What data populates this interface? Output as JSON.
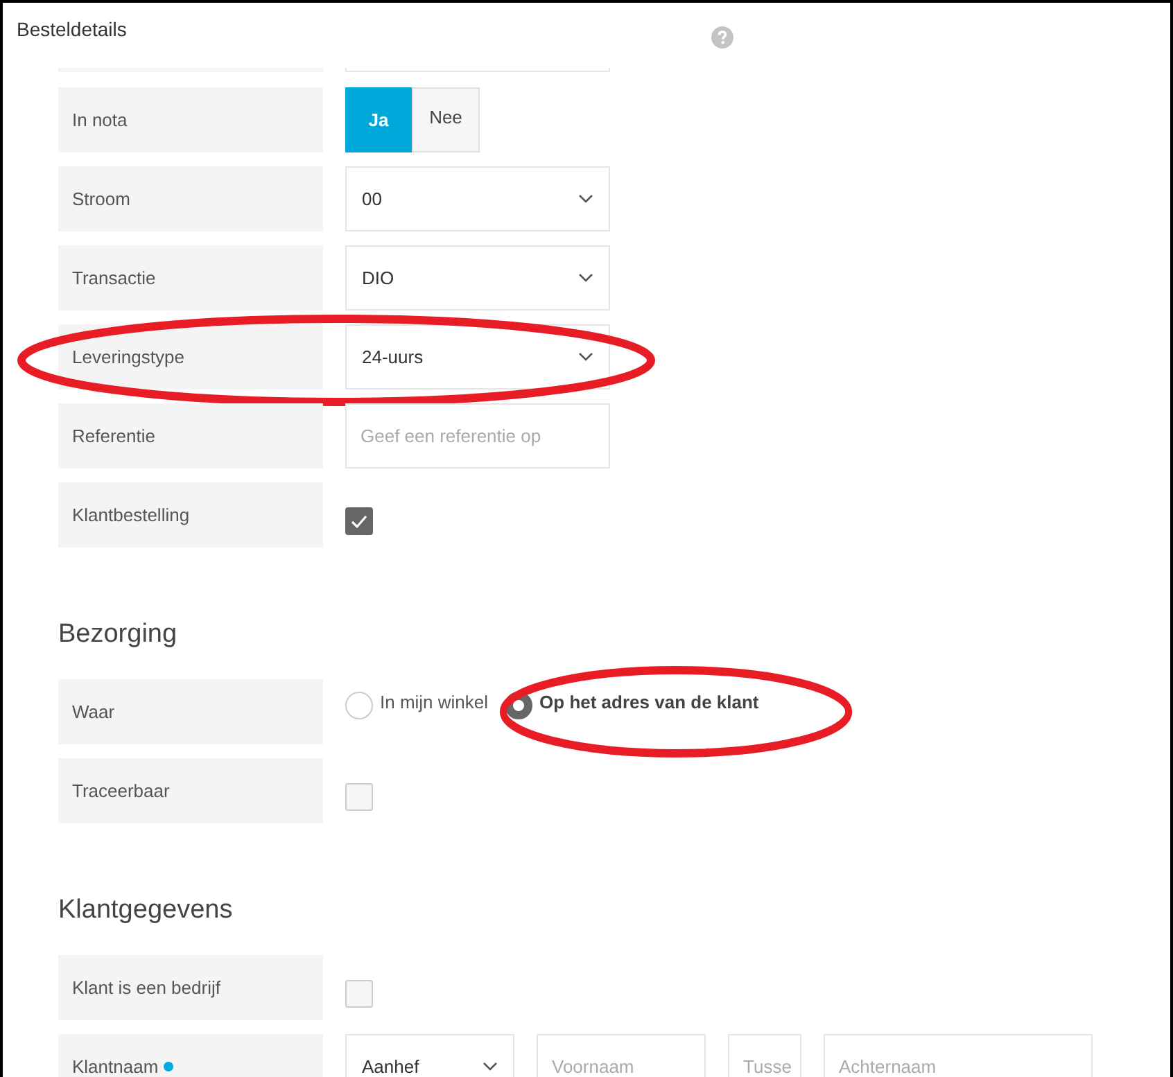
{
  "header": {
    "title": "Besteldetails"
  },
  "sections": [
    {
      "rows": [
        {
          "kind": "blank"
        },
        {
          "kind": "toggle",
          "label": "In nota",
          "options": [
            {
              "label": "Ja",
              "selected": true
            },
            {
              "label": "Nee",
              "selected": false
            }
          ]
        },
        {
          "kind": "select",
          "label": "Stroom",
          "value": "00"
        },
        {
          "kind": "select",
          "label": "Transactie",
          "value": "DIO"
        },
        {
          "kind": "select",
          "label": "Leveringstype",
          "value": "24-uurs",
          "circled": true
        },
        {
          "kind": "text",
          "label": "Referentie",
          "placeholder": "Geef een referentie op"
        },
        {
          "kind": "checkbox",
          "label": "Klantbestelling",
          "checked": true
        }
      ]
    },
    {
      "title": "Bezorging",
      "rows": [
        {
          "kind": "radio",
          "label": "Waar",
          "options": [
            {
              "label": "In mijn winkel",
              "selected": false,
              "circled": false
            },
            {
              "label": "Op het adres van de klant",
              "selected": true,
              "circled": true
            }
          ]
        },
        {
          "kind": "checkbox",
          "label": "Traceerbaar",
          "checked": false
        }
      ]
    },
    {
      "title": "Klantgegevens",
      "rows": [
        {
          "kind": "checkbox",
          "label": "Klant is een bedrijf",
          "checked": false
        },
        {
          "kind": "name",
          "label": "Klantnaam",
          "required": true,
          "fields": [
            {
              "kind": "select",
              "value": "Aanhef"
            },
            {
              "kind": "text",
              "placeholder": "Voornaam"
            },
            {
              "kind": "text",
              "placeholder": "Tusse"
            },
            {
              "kind": "text",
              "placeholder": "Achternaam"
            }
          ]
        }
      ]
    }
  ]
}
